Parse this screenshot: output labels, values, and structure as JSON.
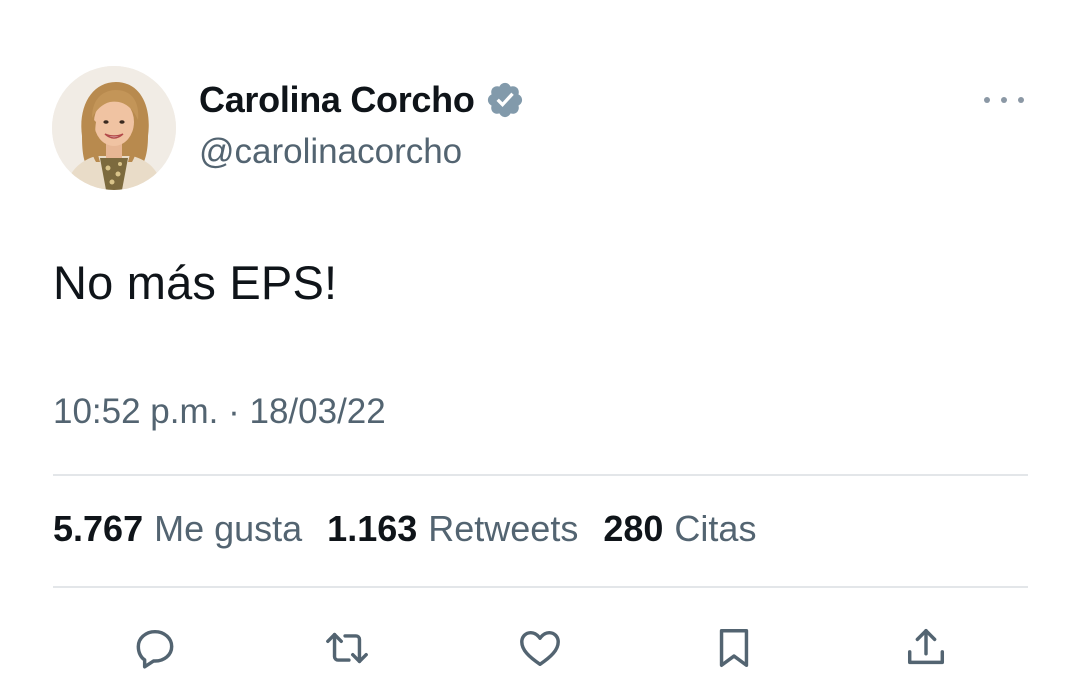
{
  "author": {
    "display_name": "Carolina Corcho",
    "handle": "@carolinacorcho",
    "verified": true
  },
  "tweet": {
    "text": "No más EPS!",
    "timestamp": "10:52 p.m. · 18/03/22"
  },
  "stats": {
    "likes_count": "5.767",
    "likes_label": "Me gusta",
    "retweets_count": "1.163",
    "retweets_label": "Retweets",
    "quotes_count": "280",
    "quotes_label": "Citas"
  },
  "icons": {
    "verified": "verified-badge-icon",
    "more": "more-options-icon",
    "reply": "reply-icon",
    "retweet": "retweet-icon",
    "like": "like-heart-icon",
    "bookmark": "bookmark-icon",
    "share": "share-icon"
  },
  "colors": {
    "text_primary": "#0f1419",
    "text_secondary": "#536471",
    "verified_badge": "#829aab",
    "icon": "#536471",
    "divider": "#e3e6e9"
  }
}
